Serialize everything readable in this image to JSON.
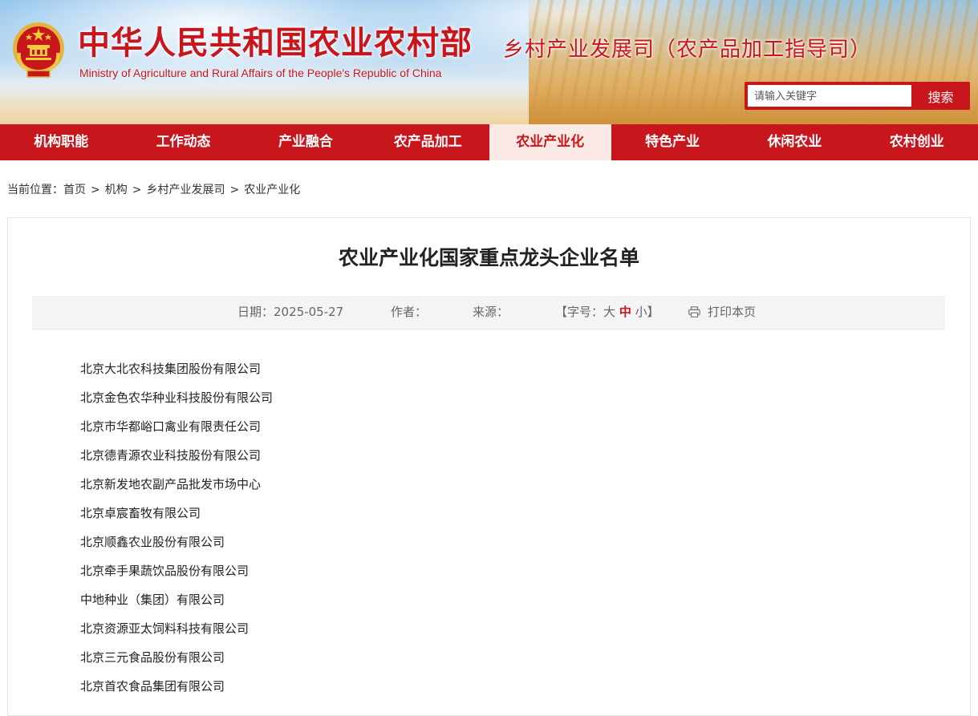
{
  "header": {
    "site_title": "中华人民共和国农业农村部",
    "site_subtitle": "Ministry of Agriculture and Rural Affairs of the People's Republic of China",
    "dept_title": "乡村产业发展司（农产品加工指导司）",
    "search": {
      "placeholder": "请输入关键字",
      "button_label": "搜索"
    }
  },
  "nav": {
    "items": [
      {
        "label": "机构职能"
      },
      {
        "label": "工作动态"
      },
      {
        "label": "产业融合"
      },
      {
        "label": "农产品加工"
      },
      {
        "label": "农业产业化"
      },
      {
        "label": "特色产业"
      },
      {
        "label": "休闲农业"
      },
      {
        "label": "农村创业"
      }
    ],
    "active_index": 4
  },
  "breadcrumb": {
    "prefix": "当前位置：",
    "items": [
      "首页",
      "机构",
      "乡村产业发展司",
      "农业产业化"
    ],
    "separator": ">"
  },
  "article": {
    "title": "农业产业化国家重点龙头企业名单",
    "meta": {
      "date_label": "日期：",
      "date": "2025-05-27",
      "author_label": "作者：",
      "source_label": "来源：",
      "fontsize_open": "【字号：",
      "fontsize_large": "大",
      "fontsize_medium": "中",
      "fontsize_small": "小",
      "fontsize_close": "】",
      "print_label": "打印本页"
    },
    "companies": [
      "北京大北农科技集团股份有限公司",
      "北京金色农华种业科技股份有限公司",
      "北京市华都峪口禽业有限责任公司",
      "北京德青源农业科技股份有限公司",
      "北京新发地农副产品批发市场中心",
      "北京卓宸畜牧有限公司",
      "北京顺鑫农业股份有限公司",
      "北京牵手果蔬饮品股份有限公司",
      "中地种业（集团）有限公司",
      "北京资源亚太饲料科技有限公司",
      "北京三元食品股份有限公司",
      "北京首农食品集团有限公司"
    ]
  },
  "colors": {
    "brand_red": "#c8161d",
    "nav_active_bg": "#fbe9e6"
  }
}
